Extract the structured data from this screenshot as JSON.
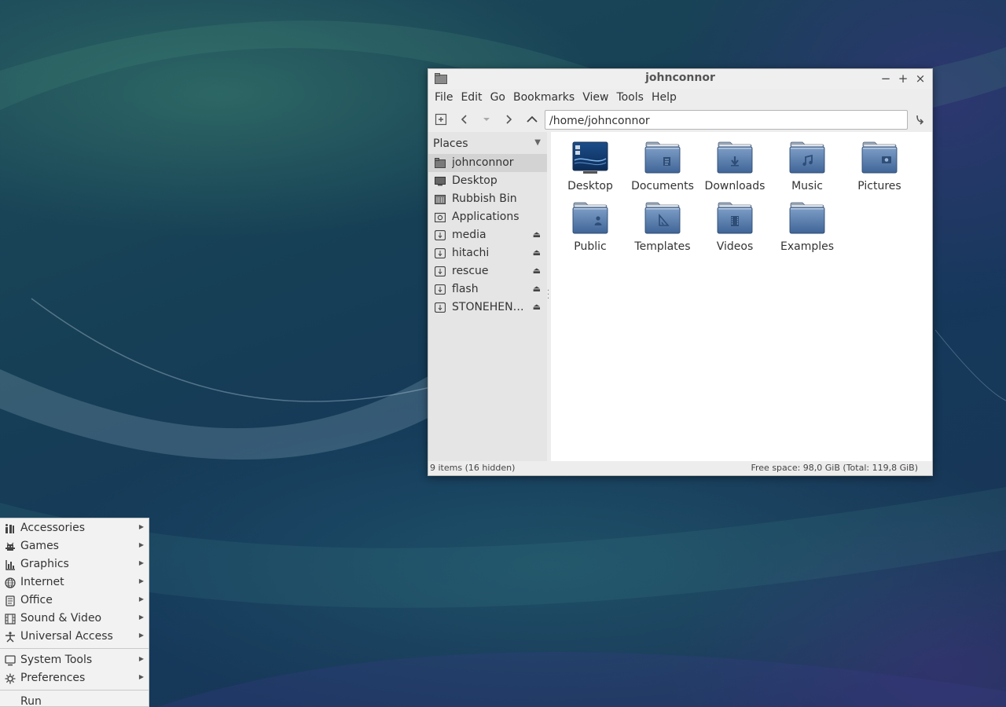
{
  "window": {
    "title": "johnconnor",
    "controls": {
      "minimize": "−",
      "maximize": "+",
      "close": "×"
    }
  },
  "menubar": [
    "File",
    "Edit",
    "Go",
    "Bookmarks",
    "View",
    "Tools",
    "Help"
  ],
  "toolbar": {
    "path": "/home/johnconnor",
    "icons": [
      "new-tab-icon",
      "back-icon",
      "history-dropdown-icon",
      "forward-icon",
      "up-icon",
      "go-icon"
    ]
  },
  "sidebar": {
    "header": "Places",
    "items": [
      {
        "label": "johnconnor",
        "icon": "home-folder-icon",
        "selected": true,
        "eject": false
      },
      {
        "label": "Desktop",
        "icon": "desktop-icon",
        "selected": false,
        "eject": false
      },
      {
        "label": "Rubbish Bin",
        "icon": "trash-icon",
        "selected": false,
        "eject": false
      },
      {
        "label": "Applications",
        "icon": "applications-icon",
        "selected": false,
        "eject": false
      },
      {
        "label": "media",
        "icon": "usb-drive-icon",
        "selected": false,
        "eject": true
      },
      {
        "label": "hitachi",
        "icon": "usb-drive-icon",
        "selected": false,
        "eject": true
      },
      {
        "label": "rescue",
        "icon": "usb-drive-icon",
        "selected": false,
        "eject": true
      },
      {
        "label": "flash",
        "icon": "usb-drive-icon",
        "selected": false,
        "eject": true
      },
      {
        "label": "STONEHEN…",
        "icon": "usb-drive-icon",
        "selected": false,
        "eject": true
      }
    ],
    "eject_glyph": "⏏"
  },
  "files": [
    {
      "name": "Desktop",
      "icon": "desktop-folder-icon"
    },
    {
      "name": "Documents",
      "icon": "documents-folder-icon"
    },
    {
      "name": "Downloads",
      "icon": "downloads-folder-icon"
    },
    {
      "name": "Music",
      "icon": "music-folder-icon"
    },
    {
      "name": "Pictures",
      "icon": "pictures-folder-icon"
    },
    {
      "name": "Public",
      "icon": "public-folder-icon"
    },
    {
      "name": "Templates",
      "icon": "templates-folder-icon"
    },
    {
      "name": "Videos",
      "icon": "videos-folder-icon"
    },
    {
      "name": "Examples",
      "icon": "folder-icon"
    }
  ],
  "statusbar": {
    "items": "9 items (16 hidden)",
    "free_space": "Free space: 98,0 GiB (Total: 119,8 GiB)"
  },
  "app_menu": {
    "group1": [
      {
        "label": "Accessories",
        "icon": "accessories-icon"
      },
      {
        "label": "Games",
        "icon": "games-icon"
      },
      {
        "label": "Graphics",
        "icon": "graphics-icon"
      },
      {
        "label": "Internet",
        "icon": "internet-icon"
      },
      {
        "label": "Office",
        "icon": "office-icon"
      },
      {
        "label": "Sound & Video",
        "icon": "sound-video-icon"
      },
      {
        "label": "Universal Access",
        "icon": "universal-access-icon"
      }
    ],
    "group2": [
      {
        "label": "System Tools",
        "icon": "system-tools-icon"
      },
      {
        "label": "Preferences",
        "icon": "preferences-icon"
      }
    ],
    "run": "Run"
  },
  "colors": {
    "folder_blue": "#4f77a8",
    "selection": "#d3d3d3"
  }
}
